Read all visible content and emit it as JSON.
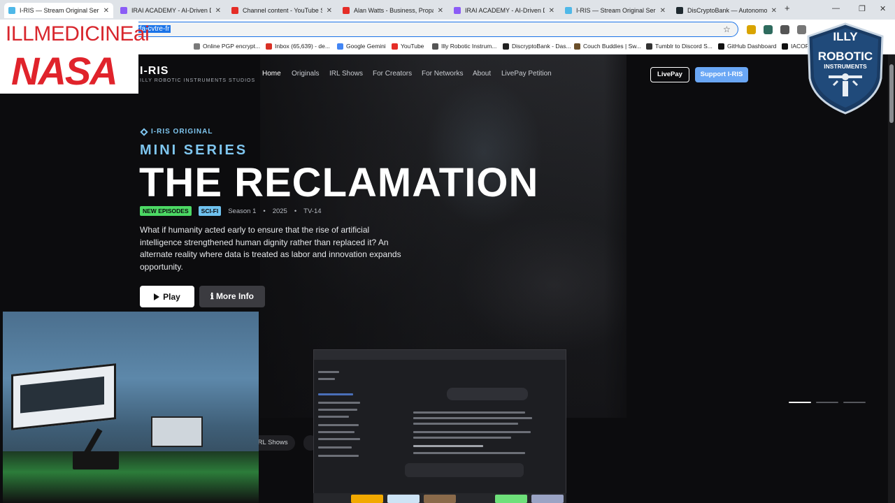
{
  "browser": {
    "tabs": [
      {
        "title": "I-RIS — Stream Original Series",
        "favicon_color": "#4fb8e8",
        "active": true
      },
      {
        "title": "IRAI ACADEMY - AI-Driven Dev",
        "favicon_color": "#8b5cf6",
        "active": false
      },
      {
        "title": "Channel content - YouTube Stu",
        "favicon_color": "#e52d27",
        "active": false
      },
      {
        "title": "Alan Watts - Business, Propaga",
        "favicon_color": "#e52d27",
        "active": false
      },
      {
        "title": "IRAI ACADEMY - AI-Driven Dev",
        "favicon_color": "#8b5cf6",
        "active": false
      },
      {
        "title": "I-RIS — Stream Original Series",
        "favicon_color": "#4fb8e8",
        "active": false
      },
      {
        "title": "DisCryptoBank — Autonomous",
        "favicon_color": "#1f2a30",
        "active": false
      }
    ],
    "new_tab": "+",
    "url_selected": "illy-rrcom/rfa-cvtre-fr",
    "window_controls": [
      "—",
      "❐",
      "✕"
    ],
    "bookmarks": [
      {
        "label": "Online PGP encrypt...",
        "color": "#7a7a7a"
      },
      {
        "label": "Inbox (65,639) - de...",
        "color": "#d93025"
      },
      {
        "label": "Google Gemini",
        "color": "#4285f4"
      },
      {
        "label": "YouTube",
        "color": "#e52d27"
      },
      {
        "label": "Illy Robotic Instrum...",
        "color": "#555555"
      },
      {
        "label": "DiscryptoBank - Das...",
        "color": "#222222"
      },
      {
        "label": "Couch Buddies | Sw...",
        "color": "#6b4f2a"
      },
      {
        "label": "Tumblr to Discord S...",
        "color": "#333333"
      },
      {
        "label": "GitHub Dashboard",
        "color": "#111111"
      },
      {
        "label": "IACORI",
        "color": "#111111"
      }
    ]
  },
  "site": {
    "brand": "I-RIS",
    "brand_sub": "ILLY ROBOTIC INSTRUMENTS STUDIOS",
    "nav": [
      "Home",
      "Originals",
      "IRL Shows",
      "For Creators",
      "For Networks",
      "About",
      "LivePay Petition"
    ],
    "livepay_label": "LivePay",
    "support_label": "Support I-RIS",
    "hero": {
      "eyebrow": "I-RIS ORIGINAL",
      "series": "MINI SERIES",
      "title": "THE RECLAMATION",
      "badge_new": "NEW EPISODES",
      "badge_genre": "SCI-FI",
      "season": "Season 1",
      "year": "2025",
      "rating": "TV-14",
      "description": "What if humanity acted early to ensure that the rise of artificial intelligence strengthened human dignity rather than replaced it? An alternate reality where data is treated as labor and innovation expands opportunity.",
      "play_label": "Play",
      "info_label": "ℹ More Info"
    },
    "chips": [
      "IRL Shows"
    ]
  },
  "overlays": {
    "watermark_top": "ILLMEDICINEai",
    "watermark_nasa": "NASA",
    "logo_line1": "ILLY",
    "logo_line2": "ROBOTIC",
    "logo_line3": "INSTRUMENTS"
  },
  "colors": {
    "accent_cyan": "#7fc6ef",
    "badge_green": "#4cd964",
    "badge_blue": "#6fc2ef",
    "support_blue": "#6aa7f5"
  }
}
